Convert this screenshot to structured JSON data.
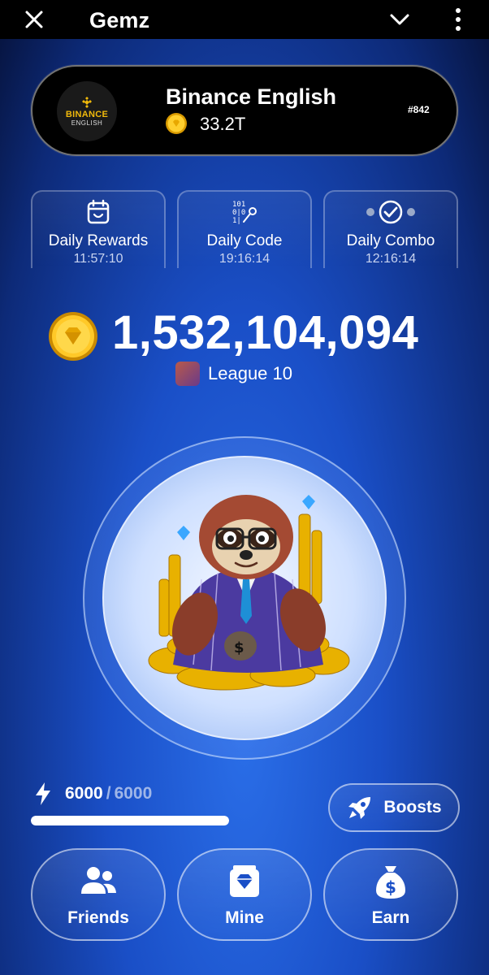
{
  "topbar": {
    "title": "Gemz",
    "close_icon": "close-icon",
    "chevron_icon": "chevron-down-icon",
    "menu_icon": "kebab-menu-icon"
  },
  "profile": {
    "avatar_line1": "BINANCE",
    "avatar_line2": "ENGLISH",
    "name": "Binance English",
    "balance": "33.2T",
    "rank": "#842"
  },
  "tasks": [
    {
      "label": "Daily Rewards",
      "time": "11:57:10",
      "icon": "calendar-icon"
    },
    {
      "label": "Daily Code",
      "time": "19:16:14",
      "icon": "cipher-key-icon"
    },
    {
      "label": "Daily Combo",
      "time": "12:16:14",
      "icon": "combo-check-icon"
    }
  ],
  "balance": {
    "amount": "1,532,104,094"
  },
  "league": {
    "label": "League 10"
  },
  "energy": {
    "current": "6000",
    "separator": "/",
    "max": "6000",
    "fill_fraction": 1.0
  },
  "boosts": {
    "label": "Boosts",
    "icon": "rocket-icon"
  },
  "nav": [
    {
      "label": "Friends",
      "icon": "friends-icon"
    },
    {
      "label": "Mine",
      "icon": "mine-gem-icon"
    },
    {
      "label": "Earn",
      "icon": "money-bag-icon"
    }
  ],
  "colors": {
    "accent_gold": "#f5b800",
    "binance_yellow": "#f0b90b",
    "bg_blue": "#1a4fc7",
    "dark_navy": "#06123a"
  }
}
